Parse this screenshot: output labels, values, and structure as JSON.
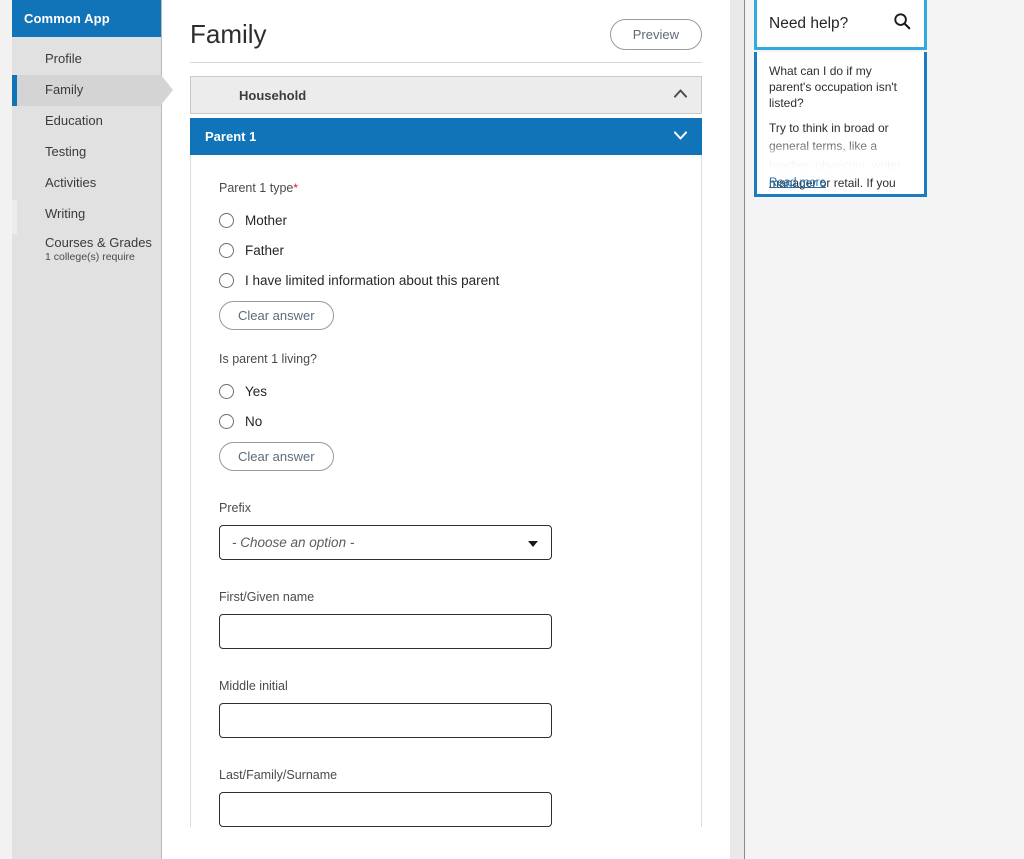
{
  "sidebar": {
    "brand": "Common App",
    "items": [
      {
        "label": "Profile",
        "sub": "",
        "active": false
      },
      {
        "label": "Family",
        "sub": "",
        "active": true
      },
      {
        "label": "Education",
        "sub": "",
        "active": false
      },
      {
        "label": "Testing",
        "sub": "",
        "active": false
      },
      {
        "label": "Activities",
        "sub": "",
        "active": false
      },
      {
        "label": "Writing",
        "sub": "",
        "active": false
      },
      {
        "label": "Courses & Grades",
        "sub": "1 college(s) require",
        "active": false
      }
    ]
  },
  "header": {
    "title": "Family",
    "preview_label": "Preview"
  },
  "accordions": [
    {
      "label": "Household",
      "expanded": true,
      "style": "grey",
      "icon": "chevron-up-icon"
    },
    {
      "label": "Parent 1",
      "expanded": false,
      "style": "blue",
      "icon": "chevron-down-icon"
    }
  ],
  "form": {
    "parent_type": {
      "label": "Parent 1 type",
      "required_marker": "*",
      "options": [
        "Mother",
        "Father",
        "I have limited information about this parent"
      ],
      "clear_label": "Clear answer"
    },
    "parent_living": {
      "label": "Is parent 1 living?",
      "options": [
        "Yes",
        "No"
      ],
      "clear_label": "Clear answer"
    },
    "prefix": {
      "label": "Prefix",
      "placeholder": "- Choose an option -",
      "value": "",
      "options": [
        "- Choose an option -"
      ]
    },
    "first_name": {
      "label": "First/Given name",
      "value": "",
      "placeholder": ""
    },
    "middle_initial": {
      "label": "Middle initial",
      "value": "",
      "placeholder": ""
    },
    "last_name": {
      "label": "Last/Family/Surname",
      "value": "",
      "placeholder": ""
    }
  },
  "help": {
    "title": "Need help?",
    "search_icon": "search-icon",
    "question": "What can I do if my parent's occupation isn't listed?",
    "answer": "Try to think in broad or general terms, like a teacher, physician, writer, manager or retail. If you are",
    "read_more": "Read more"
  },
  "colors": {
    "brand_blue": "#1274b8",
    "light_blue": "#33aadd",
    "sidebar_bg": "#e1e1e1",
    "active_item": "#d4d4d4",
    "required_red": "#e8112d",
    "page_bg": "#f4f4f4"
  }
}
